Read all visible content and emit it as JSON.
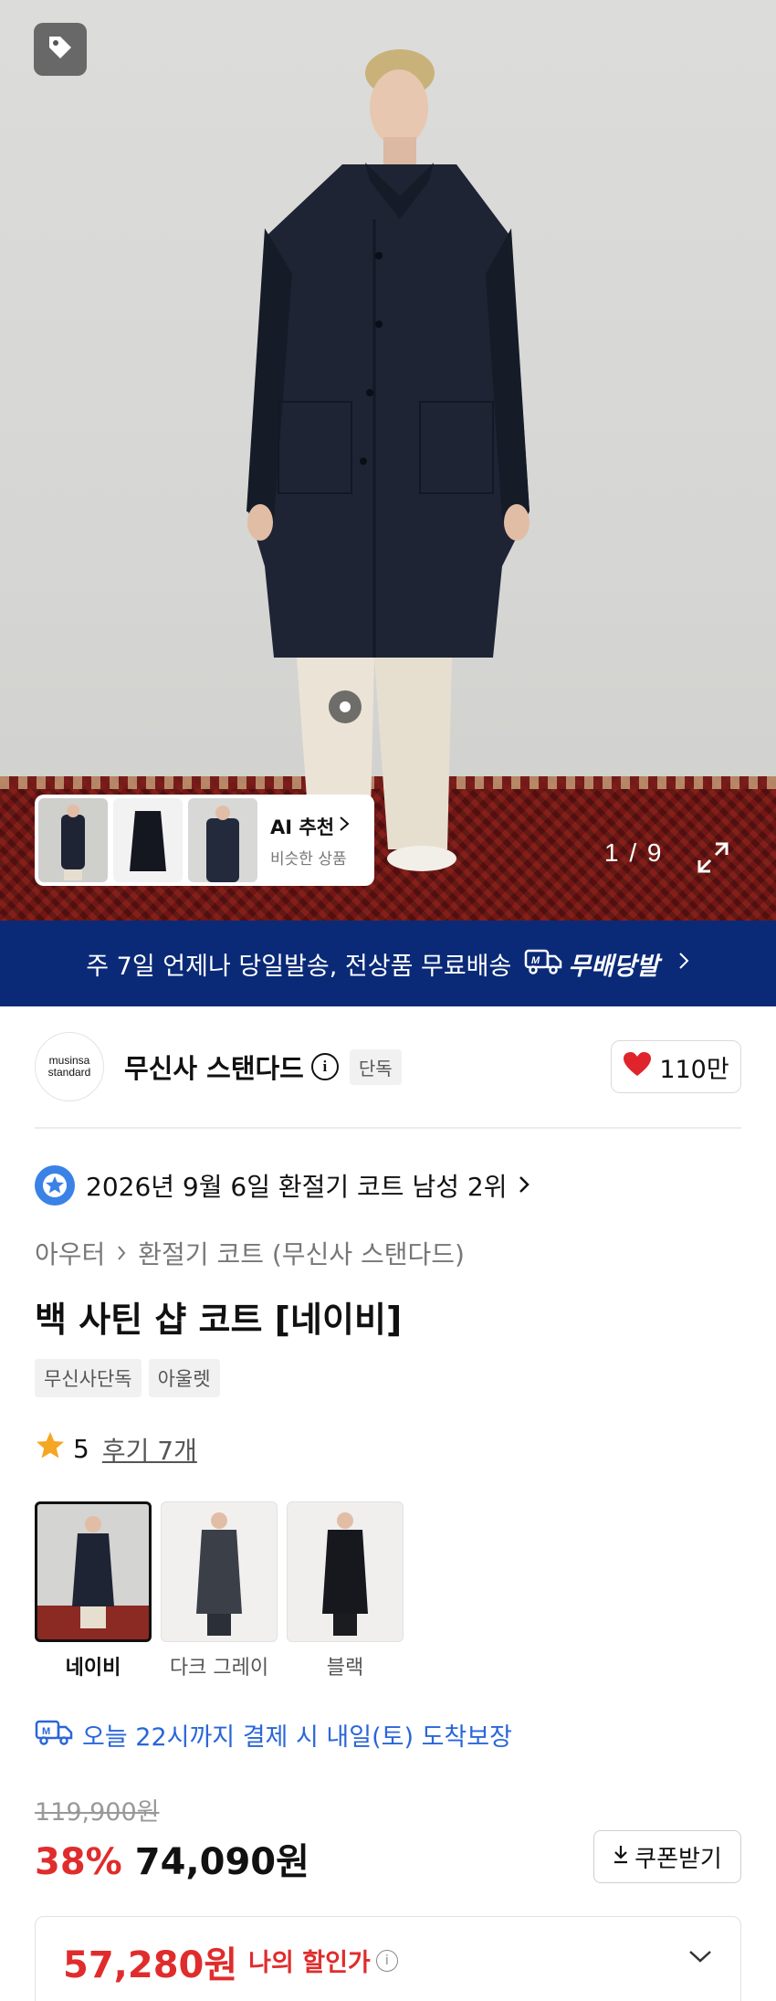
{
  "hero": {
    "ai_card": {
      "title": "AI 추천",
      "subtitle": "비슷한 상품"
    },
    "counter": "1 / 9"
  },
  "banner": {
    "text": "주 7일 언제나 당일발송, 전상품 무료배송",
    "logo_text": "무배당발"
  },
  "brand": {
    "logo_line1": "musinsa",
    "logo_line2": "standard",
    "name": "무신사 스탠다드",
    "badge": "단독",
    "likes": "110만"
  },
  "ranking": {
    "text": "2026년 9월 6일 환절기 코트 남성 2위"
  },
  "breadcrumb": {
    "parent": "아우터",
    "child": "환절기 코트 (무신사 스탠다드)"
  },
  "product": {
    "title": "백 사틴 샵 코트 [네이비]",
    "tags": [
      "무신사단독",
      "아울렛"
    ]
  },
  "rating": {
    "score": "5",
    "reviews": "후기 7개"
  },
  "colors": [
    {
      "label": "네이비",
      "selected": true
    },
    {
      "label": "다크 그레이",
      "selected": false
    },
    {
      "label": "블랙",
      "selected": false
    }
  ],
  "delivery": {
    "text": "오늘 22시까지 결제 시 내일(토) 도착보장"
  },
  "price": {
    "original": "119,900원",
    "discount": "38%",
    "sale": "74,090원",
    "coupon_label": "쿠폰받기",
    "my_price": "57,280원",
    "my_price_label": "나의 할인가"
  },
  "colors_theme": {
    "banner": "#0a2a78",
    "discount": "#e02c2c",
    "delivery": "#2a66d9",
    "heart": "#e0242c"
  }
}
